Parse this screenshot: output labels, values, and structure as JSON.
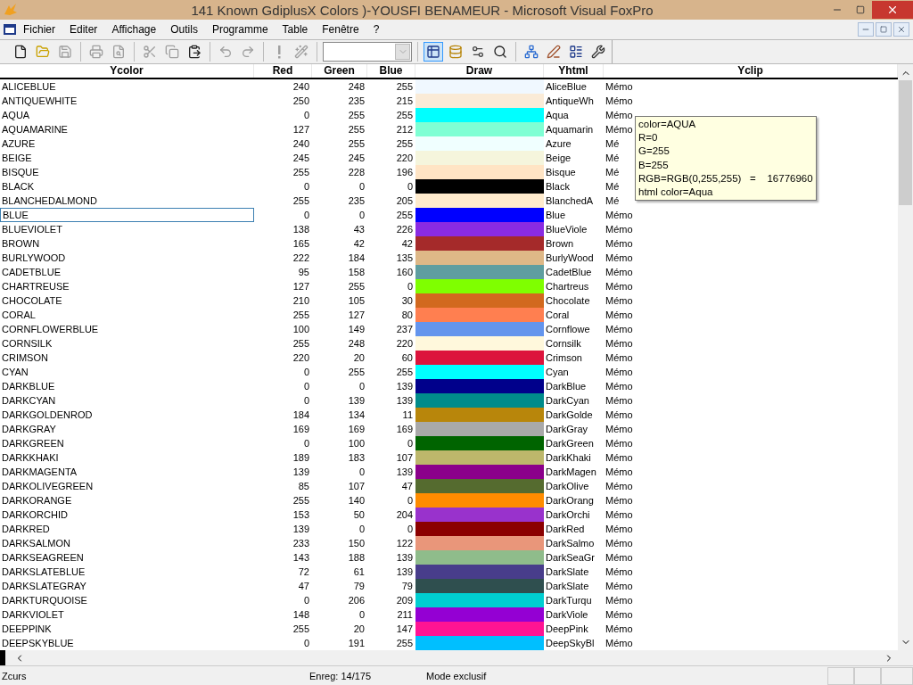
{
  "window": {
    "title": "141 Known GdiplusX Colors )-YOUSFI BENAMEUR  - Microsoft Visual FoxPro"
  },
  "menu": [
    "Fichier",
    "Editer",
    "Affichage",
    "Outils",
    "Programme",
    "Table",
    "Fenêtre",
    "?"
  ],
  "toolbar": [
    {
      "kind": "icon",
      "disabled": false
    },
    {
      "kind": "icon",
      "disabled": false
    },
    {
      "kind": "icon",
      "disabled": true
    },
    {
      "kind": "sep"
    },
    {
      "kind": "icon",
      "disabled": true
    },
    {
      "kind": "icon",
      "disabled": true
    },
    {
      "kind": "sep"
    },
    {
      "kind": "icon",
      "disabled": true
    },
    {
      "kind": "icon",
      "disabled": true
    },
    {
      "kind": "icon",
      "disabled": false
    },
    {
      "kind": "sep"
    },
    {
      "kind": "icon",
      "disabled": true
    },
    {
      "kind": "icon",
      "disabled": true
    },
    {
      "kind": "sep"
    },
    {
      "kind": "icon",
      "disabled": true
    },
    {
      "kind": "icon",
      "disabled": true
    },
    {
      "kind": "sep"
    },
    {
      "kind": "combo",
      "disabled": true
    },
    {
      "kind": "sep"
    },
    {
      "kind": "icon",
      "disabled": false,
      "selected": true
    },
    {
      "kind": "icon",
      "disabled": false,
      "selected": false
    },
    {
      "kind": "icon",
      "disabled": false,
      "selected": false
    },
    {
      "kind": "icon",
      "disabled": false,
      "selected": false
    },
    {
      "kind": "sep"
    },
    {
      "kind": "icon",
      "disabled": false,
      "selected": false
    },
    {
      "kind": "icon",
      "disabled": false,
      "selected": false
    },
    {
      "kind": "icon",
      "disabled": false,
      "selected": false
    },
    {
      "kind": "icon",
      "disabled": false,
      "selected": false
    }
  ],
  "table": {
    "columns": [
      "Ycolor",
      "Red",
      "Green",
      "Blue",
      "Draw",
      "Yhtml",
      "Yclip"
    ],
    "rows": [
      {
        "ycolor": "ALICEBLUE",
        "red": "240",
        "green": "248",
        "blue": "255",
        "yhtml": "AliceBlue",
        "yclip": "Mémo",
        "selected": false
      },
      {
        "ycolor": "ANTIQUEWHITE",
        "red": "250",
        "green": "235",
        "blue": "215",
        "yhtml": "AntiqueWh",
        "yclip": "Mémo",
        "selected": false
      },
      {
        "ycolor": "AQUA",
        "red": "0",
        "green": "255",
        "blue": "255",
        "yhtml": "Aqua",
        "yclip": "Mémo",
        "selected": false
      },
      {
        "ycolor": "AQUAMARINE",
        "red": "127",
        "green": "255",
        "blue": "212",
        "yhtml": "Aquamarin",
        "yclip": "Mémo",
        "selected": false
      },
      {
        "ycolor": "AZURE",
        "red": "240",
        "green": "255",
        "blue": "255",
        "yhtml": "Azure",
        "yclip": "Mé",
        "selected": false
      },
      {
        "ycolor": "BEIGE",
        "red": "245",
        "green": "245",
        "blue": "220",
        "yhtml": "Beige",
        "yclip": "Mé",
        "selected": false
      },
      {
        "ycolor": "BISQUE",
        "red": "255",
        "green": "228",
        "blue": "196",
        "yhtml": "Bisque",
        "yclip": "Mé",
        "selected": false
      },
      {
        "ycolor": "BLACK",
        "red": "0",
        "green": "0",
        "blue": "0",
        "yhtml": "Black",
        "yclip": "Mé",
        "selected": false
      },
      {
        "ycolor": "BLANCHEDALMOND",
        "red": "255",
        "green": "235",
        "blue": "205",
        "yhtml": "BlanchedA",
        "yclip": "Mé",
        "selected": false
      },
      {
        "ycolor": "BLUE",
        "red": "0",
        "green": "0",
        "blue": "255",
        "yhtml": "Blue",
        "yclip": "Mémo",
        "selected": true
      },
      {
        "ycolor": "BLUEVIOLET",
        "red": "138",
        "green": "43",
        "blue": "226",
        "yhtml": "BlueViole",
        "yclip": "Mémo",
        "selected": false
      },
      {
        "ycolor": "BROWN",
        "red": "165",
        "green": "42",
        "blue": "42",
        "yhtml": "Brown",
        "yclip": "Mémo",
        "selected": false
      },
      {
        "ycolor": "BURLYWOOD",
        "red": "222",
        "green": "184",
        "blue": "135",
        "yhtml": "BurlyWood",
        "yclip": "Mémo",
        "selected": false
      },
      {
        "ycolor": "CADETBLUE",
        "red": "95",
        "green": "158",
        "blue": "160",
        "yhtml": "CadetBlue",
        "yclip": "Mémo",
        "selected": false
      },
      {
        "ycolor": "CHARTREUSE",
        "red": "127",
        "green": "255",
        "blue": "0",
        "yhtml": "Chartreus",
        "yclip": "Mémo",
        "selected": false
      },
      {
        "ycolor": "CHOCOLATE",
        "red": "210",
        "green": "105",
        "blue": "30",
        "yhtml": "Chocolate",
        "yclip": "Mémo",
        "selected": false
      },
      {
        "ycolor": "CORAL",
        "red": "255",
        "green": "127",
        "blue": "80",
        "yhtml": "Coral",
        "yclip": "Mémo",
        "selected": false
      },
      {
        "ycolor": "CORNFLOWERBLUE",
        "red": "100",
        "green": "149",
        "blue": "237",
        "yhtml": "Cornflowe",
        "yclip": "Mémo",
        "selected": false
      },
      {
        "ycolor": "CORNSILK",
        "red": "255",
        "green": "248",
        "blue": "220",
        "yhtml": "Cornsilk",
        "yclip": "Mémo",
        "selected": false
      },
      {
        "ycolor": "CRIMSON",
        "red": "220",
        "green": "20",
        "blue": "60",
        "yhtml": "Crimson",
        "yclip": "Mémo",
        "selected": false
      },
      {
        "ycolor": "CYAN",
        "red": "0",
        "green": "255",
        "blue": "255",
        "yhtml": "Cyan",
        "yclip": "Mémo",
        "selected": false
      },
      {
        "ycolor": "DARKBLUE",
        "red": "0",
        "green": "0",
        "blue": "139",
        "yhtml": "DarkBlue",
        "yclip": "Mémo",
        "selected": false
      },
      {
        "ycolor": "DARKCYAN",
        "red": "0",
        "green": "139",
        "blue": "139",
        "yhtml": "DarkCyan",
        "yclip": "Mémo",
        "selected": false
      },
      {
        "ycolor": "DARKGOLDENROD",
        "red": "184",
        "green": "134",
        "blue": "11",
        "yhtml": "DarkGolde",
        "yclip": "Mémo",
        "selected": false
      },
      {
        "ycolor": "DARKGRAY",
        "red": "169",
        "green": "169",
        "blue": "169",
        "yhtml": "DarkGray",
        "yclip": "Mémo",
        "selected": false
      },
      {
        "ycolor": "DARKGREEN",
        "red": "0",
        "green": "100",
        "blue": "0",
        "yhtml": "DarkGreen",
        "yclip": "Mémo",
        "selected": false
      },
      {
        "ycolor": "DARKKHAKI",
        "red": "189",
        "green": "183",
        "blue": "107",
        "yhtml": "DarkKhaki",
        "yclip": "Mémo",
        "selected": false
      },
      {
        "ycolor": "DARKMAGENTA",
        "red": "139",
        "green": "0",
        "blue": "139",
        "yhtml": "DarkMagen",
        "yclip": "Mémo",
        "selected": false
      },
      {
        "ycolor": "DARKOLIVEGREEN",
        "red": "85",
        "green": "107",
        "blue": "47",
        "yhtml": "DarkOlive",
        "yclip": "Mémo",
        "selected": false
      },
      {
        "ycolor": "DARKORANGE",
        "red": "255",
        "green": "140",
        "blue": "0",
        "yhtml": "DarkOrang",
        "yclip": "Mémo",
        "selected": false
      },
      {
        "ycolor": "DARKORCHID",
        "red": "153",
        "green": "50",
        "blue": "204",
        "yhtml": "DarkOrchi",
        "yclip": "Mémo",
        "selected": false
      },
      {
        "ycolor": "DARKRED",
        "red": "139",
        "green": "0",
        "blue": "0",
        "yhtml": "DarkRed",
        "yclip": "Mémo",
        "selected": false
      },
      {
        "ycolor": "DARKSALMON",
        "red": "233",
        "green": "150",
        "blue": "122",
        "yhtml": "DarkSalmo",
        "yclip": "Mémo",
        "selected": false
      },
      {
        "ycolor": "DARKSEAGREEN",
        "red": "143",
        "green": "188",
        "blue": "139",
        "yhtml": "DarkSeaGr",
        "yclip": "Mémo",
        "selected": false
      },
      {
        "ycolor": "DARKSLATEBLUE",
        "red": "72",
        "green": "61",
        "blue": "139",
        "yhtml": "DarkSlate",
        "yclip": "Mémo",
        "selected": false
      },
      {
        "ycolor": "DARKSLATEGRAY",
        "red": "47",
        "green": "79",
        "blue": "79",
        "yhtml": "DarkSlate",
        "yclip": "Mémo",
        "selected": false
      },
      {
        "ycolor": "DARKTURQUOISE",
        "red": "0",
        "green": "206",
        "blue": "209",
        "yhtml": "DarkTurqu",
        "yclip": "Mémo",
        "selected": false
      },
      {
        "ycolor": "DARKVIOLET",
        "red": "148",
        "green": "0",
        "blue": "211",
        "yhtml": "DarkViole",
        "yclip": "Mémo",
        "selected": false
      },
      {
        "ycolor": "DEEPPINK",
        "red": "255",
        "green": "20",
        "blue": "147",
        "yhtml": "DeepPink",
        "yclip": "Mémo",
        "selected": false
      },
      {
        "ycolor": "DEEPSKYBLUE",
        "red": "0",
        "green": "191",
        "blue": "255",
        "yhtml": "DeepSkyBl",
        "yclip": "Mémo",
        "selected": false
      }
    ]
  },
  "tooltip": {
    "lines": [
      "color=AQUA",
      "R=0",
      "G=255",
      "B=255",
      "RGB=RGB(0,255,255)   =    16776960",
      "html color=Aqua"
    ]
  },
  "status_bar": {
    "panels": [
      "Zcurs",
      "Enreg: 14/175",
      "Mode exclusif"
    ]
  }
}
